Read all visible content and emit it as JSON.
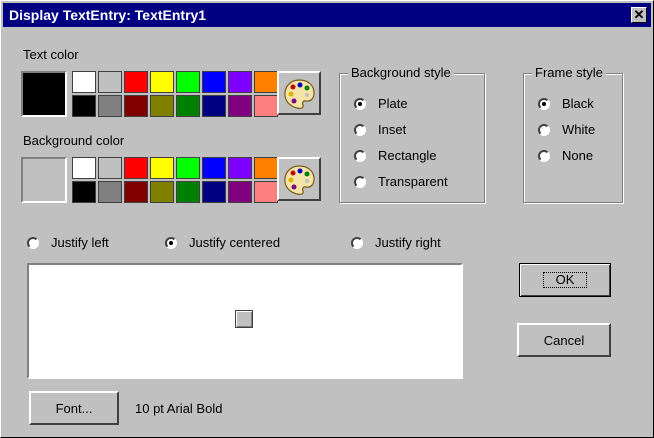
{
  "window": {
    "title": "Display TextEntry: TextEntry1",
    "close": "✕"
  },
  "text_color": {
    "label": "Text color",
    "current": "#000000",
    "palette": [
      "#ffffff",
      "#c0c0c0",
      "#ff0000",
      "#ffff00",
      "#00ff00",
      "#0000ff",
      "#8000ff",
      "#ff8000",
      "#000000",
      "#808080",
      "#800000",
      "#808000",
      "#008000",
      "#000080",
      "#800080",
      "#ff8080"
    ]
  },
  "background_color": {
    "label": "Background color",
    "current": "#c0c0c0",
    "palette": [
      "#ffffff",
      "#c0c0c0",
      "#ff0000",
      "#ffff00",
      "#00ff00",
      "#0000ff",
      "#8000ff",
      "#ff8000",
      "#000000",
      "#808080",
      "#800000",
      "#808000",
      "#008000",
      "#000080",
      "#800080",
      "#ff8080"
    ]
  },
  "background_style": {
    "label": "Background style",
    "options": [
      {
        "label": "Plate",
        "selected": true
      },
      {
        "label": "Inset",
        "selected": false
      },
      {
        "label": "Rectangle",
        "selected": false
      },
      {
        "label": "Transparent",
        "selected": false
      }
    ]
  },
  "frame_style": {
    "label": "Frame style",
    "options": [
      {
        "label": "Black",
        "selected": true
      },
      {
        "label": "White",
        "selected": false
      },
      {
        "label": "None",
        "selected": false
      }
    ]
  },
  "justify": {
    "options": [
      {
        "label": "Justify left",
        "selected": false
      },
      {
        "label": "Justify centered",
        "selected": true
      },
      {
        "label": "Justify right",
        "selected": false
      }
    ]
  },
  "buttons": {
    "ok": "OK",
    "cancel": "Cancel",
    "font": "Font..."
  },
  "font_desc": "10 pt Arial Bold"
}
